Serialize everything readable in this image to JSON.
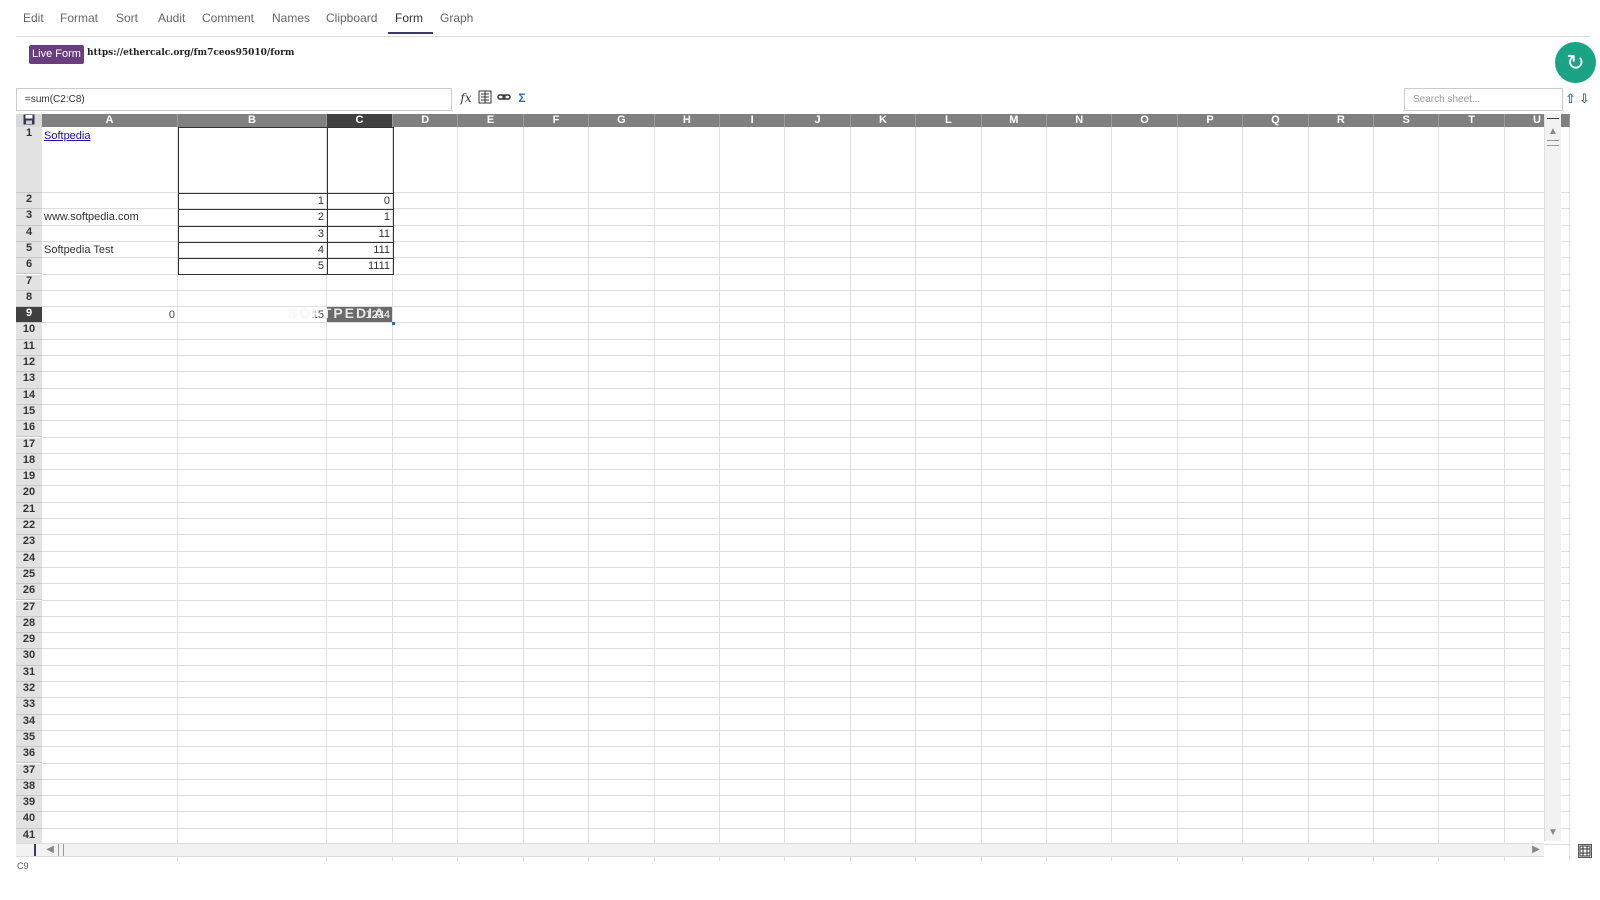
{
  "menu": {
    "tabs": [
      {
        "label": "Edit"
      },
      {
        "label": "Format"
      },
      {
        "label": "Sort"
      },
      {
        "label": "Audit"
      },
      {
        "label": "Comment"
      },
      {
        "label": "Names"
      },
      {
        "label": "Clipboard"
      },
      {
        "label": "Form"
      },
      {
        "label": "Graph"
      }
    ],
    "active": "Form"
  },
  "liveform": {
    "button_label": "Live Form",
    "url": "https://ethercalc.org/fm7ceos95010/form"
  },
  "formula_bar": {
    "value": "=sum(C2:C8)",
    "search_placeholder": "Search sheet..."
  },
  "grid": {
    "columns": [
      "A",
      "B",
      "C",
      "D",
      "E",
      "F",
      "G",
      "H",
      "I",
      "J",
      "K",
      "L",
      "M",
      "N",
      "O",
      "P",
      "Q",
      "R",
      "S",
      "T",
      "U"
    ],
    "rows": [
      "1",
      "2",
      "3",
      "4",
      "5",
      "6",
      "7",
      "8",
      "9",
      "10",
      "11",
      "12",
      "13",
      "14",
      "15",
      "16",
      "17",
      "18",
      "19",
      "20",
      "21",
      "22",
      "23",
      "24",
      "25",
      "26",
      "27",
      "28",
      "29",
      "30",
      "31",
      "32",
      "33",
      "34",
      "35",
      "36",
      "37",
      "38",
      "39",
      "40",
      "41"
    ],
    "selected_col": "C",
    "selected_row": "9",
    "cells": {
      "A1": "Softpedia",
      "A3": "www.softpedia.com",
      "A5": "Softpedia Test",
      "B2": "1",
      "B3": "2",
      "B4": "3",
      "B5": "4",
      "B6": "5",
      "C2": "0",
      "C3": "1",
      "C4": "11",
      "C5": "111",
      "C6": "1111",
      "A9": "0",
      "B9": "15",
      "C9": "1234"
    },
    "watermark": "SOFTPEDIA"
  },
  "status": {
    "cell_ref": "C9"
  },
  "colors": {
    "accent": "#3a3a6a",
    "liveform_bg": "#6a3e7e",
    "refresh_bg": "#1aa385",
    "header_bg": "#808080",
    "selected_header_bg": "#404040"
  }
}
